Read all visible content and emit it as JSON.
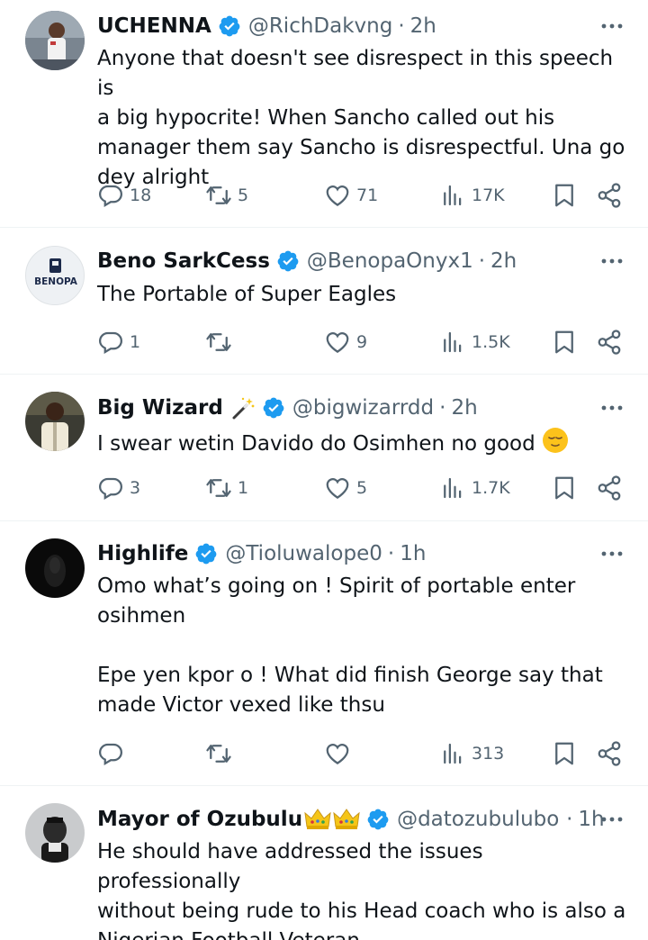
{
  "tweets": [
    {
      "name": "UCHENNA",
      "handle": "@RichDakvng",
      "time": "2h",
      "text": "Anyone that doesn't see disrespect in this speech is\na big hypocrite! When Sancho called out his\nmanager them say Sancho is disrespectful. Una go\ndey alright",
      "replies": "18",
      "reposts": "5",
      "likes": "71",
      "views": "17K"
    },
    {
      "name": "Beno SarkCess",
      "handle": "@BenopaOnyx1",
      "time": "2h",
      "text": "The Portable of Super Eagles",
      "avatar_text": "BENOPA",
      "replies": "1",
      "reposts": "",
      "likes": "9",
      "views": "1.5K"
    },
    {
      "name": "Big Wizard",
      "handle": "@bigwizarrdd",
      "time": "2h",
      "text": "I swear wetin Davido do Osimhen no good",
      "replies": "3",
      "reposts": "1",
      "likes": "5",
      "views": "1.7K"
    },
    {
      "name": "Highlife",
      "handle": "@Tioluwalope0",
      "time": "1h",
      "text": "Omo what’s going on ! Spirit of portable enter\nosihmen\n\nEpe yen kpor o ! What did finish George say that\nmade Victor vexed like thsu",
      "replies": "",
      "reposts": "",
      "likes": "",
      "views": "313"
    },
    {
      "name": "Mayor of Ozubulu",
      "handle": "@datozubuluboi",
      "time": "1h",
      "text": "He should have addressed the issues professionally\nwithout being rude to his Head coach who is also a\nNigerian Football Veteran"
    }
  ],
  "separator": "·",
  "icons": {
    "verified": "verified-badge-icon",
    "more": "more-dots-icon",
    "reply": "reply-icon",
    "repost": "repost-icon",
    "like": "like-icon",
    "views": "views-icon",
    "bookmark": "bookmark-icon",
    "share": "share-icon"
  },
  "colors": {
    "text": "#0f1419",
    "secondary": "#536471",
    "verified": "#1d9bf0",
    "divider": "#eff3f4"
  }
}
